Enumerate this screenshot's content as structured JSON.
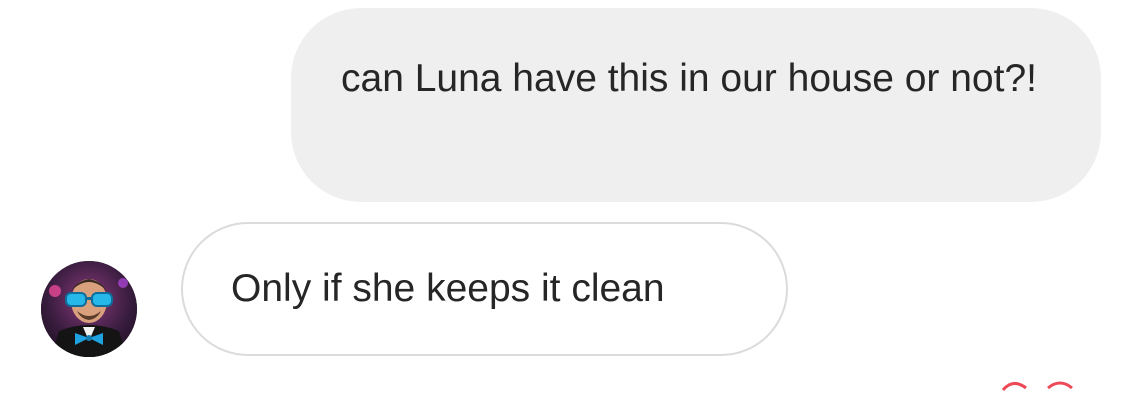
{
  "messages": {
    "outgoing": {
      "text": "can Luna have this in our house or not?!"
    },
    "incoming": {
      "text": "Only if she keeps it clean",
      "avatar_icon": "user-avatar-icon"
    }
  },
  "colors": {
    "outgoing_bubble": "#efefef",
    "incoming_border": "#dbdbdb",
    "text": "#262626",
    "accent": "#ed4956"
  }
}
